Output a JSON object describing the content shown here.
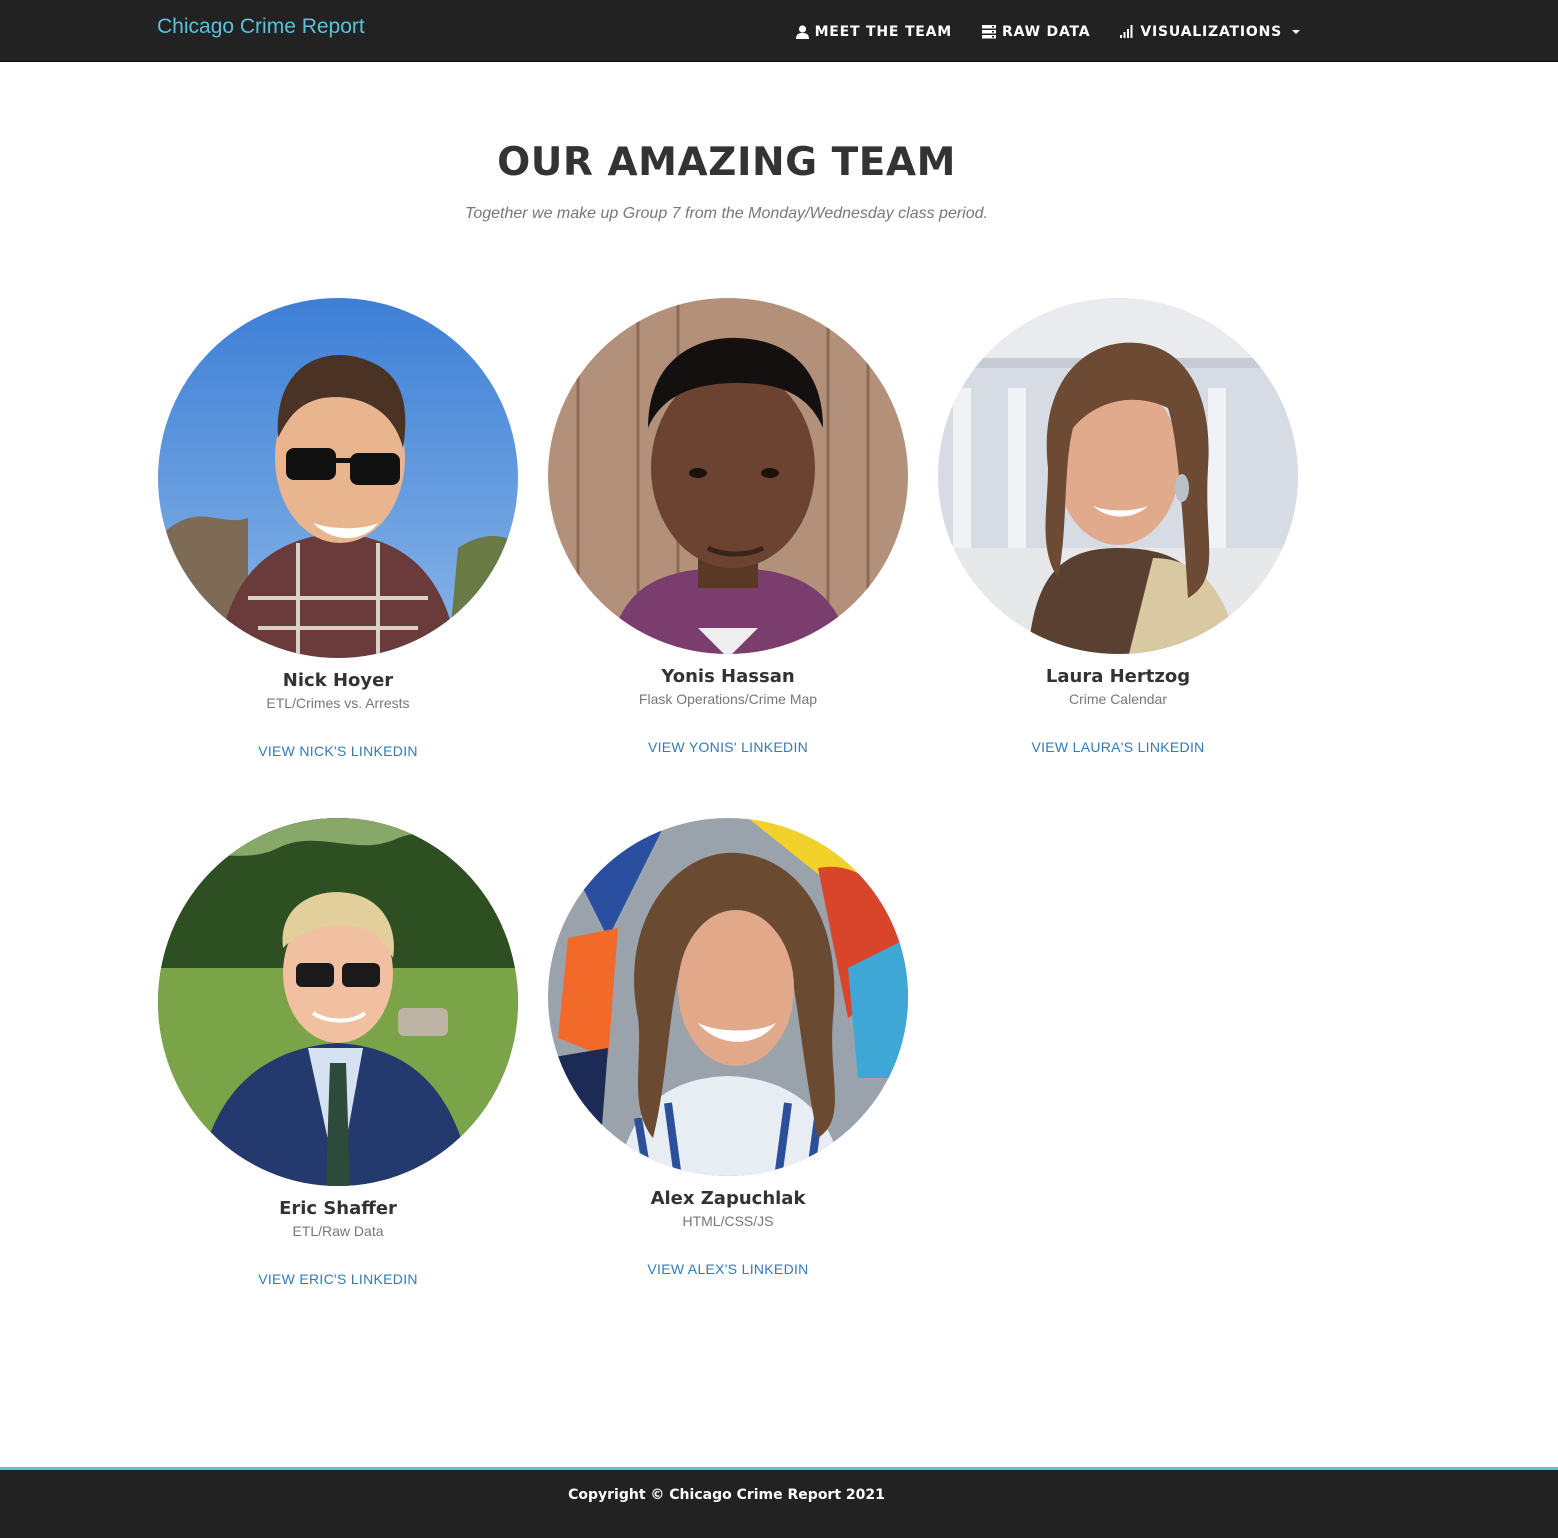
{
  "navbar": {
    "brand": "Chicago Crime Report",
    "items": [
      {
        "label": "MEET THE TEAM",
        "icon": "user-icon"
      },
      {
        "label": "RAW DATA",
        "icon": "database-icon"
      },
      {
        "label": "VISUALIZATIONS",
        "icon": "signal-icon",
        "dropdown": true
      }
    ]
  },
  "section": {
    "heading": "OUR AMAZING TEAM",
    "subheading": "Together we make up Group 7 from the Monday/Wednesday class period."
  },
  "team": [
    {
      "name": "Nick Hoyer",
      "role": "ETL/Crimes vs. Arrests",
      "link": "VIEW NICK'S LINKEDIN"
    },
    {
      "name": "Yonis Hassan",
      "role": "Flask Operations/Crime Map",
      "link": "VIEW YONIS' LINKEDIN"
    },
    {
      "name": "Laura Hertzog",
      "role": "Crime Calendar",
      "link": "VIEW LAURA'S LINKEDIN"
    },
    {
      "name": "Eric Shaffer",
      "role": "ETL/Raw Data",
      "link": "VIEW ERIC'S LINKEDIN"
    },
    {
      "name": "Alex Zapuchlak",
      "role": "HTML/CSS/JS",
      "link": "VIEW ALEX'S LINKEDIN"
    }
  ],
  "footer": {
    "copyright": "Copyright © Chicago Crime Report 2021"
  },
  "colors": {
    "navbar_bg": "#222222",
    "brand": "#5bc0de",
    "link": "#337ab7",
    "footer_border": "#5bc0de"
  }
}
